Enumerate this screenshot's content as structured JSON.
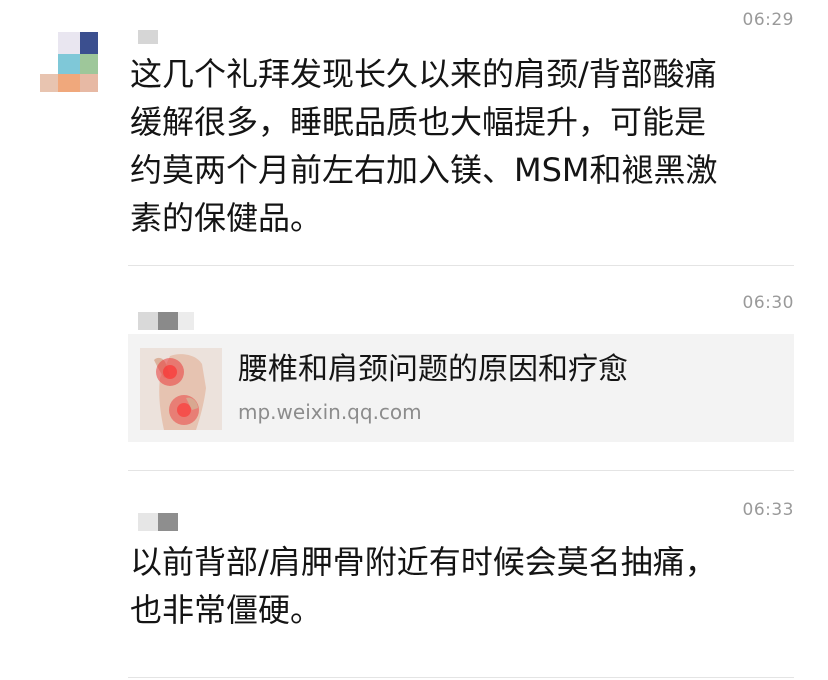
{
  "posts": [
    {
      "time": "06:29",
      "text": "这几个礼拜发现长久以来的肩颈/背部酸痛\n缓解很多，睡眠品质也大幅提升，可能是\n约莫两个月前左右加入镁、MSM和褪黑激\n素的保健品。"
    },
    {
      "time": "06:30",
      "link": {
        "title": "腰椎和肩颈问题的原因和疗愈",
        "source": "mp.weixin.qq.com"
      }
    },
    {
      "time": "06:33",
      "text": "以前背部/肩胛骨附近有时候会莫名抽痛，\n也非常僵硬。"
    }
  ],
  "colors": {
    "text": "#141414",
    "timestamp": "#9a9a9a",
    "card_background": "#f3f3f3",
    "link_source": "#8c8c8c"
  },
  "icons": {
    "avatar": "pixelated-avatar",
    "link_thumbnail": "back-pain-illustration"
  }
}
